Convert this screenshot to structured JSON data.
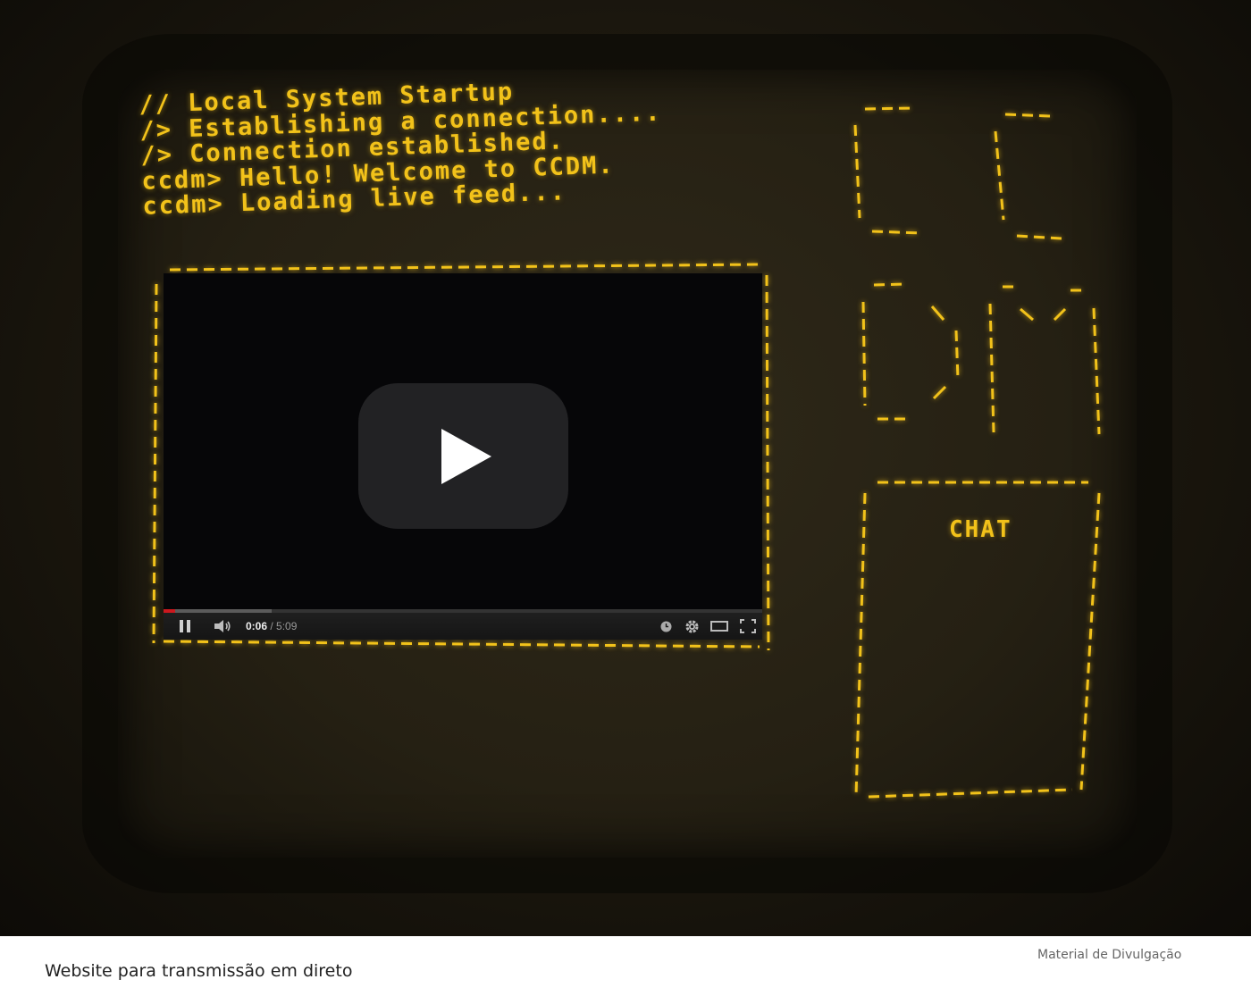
{
  "terminal": {
    "lines": [
      "// Local System Startup",
      "/> Establishing a connection....",
      "/> Connection established.",
      "ccdm> Hello! Welcome to CCDM.",
      "ccdm> Loading live feed..."
    ]
  },
  "video": {
    "current_time": "0:06",
    "separator": " / ",
    "duration": "5:09",
    "progress_fraction": 0.019,
    "buffered_fraction": 0.18,
    "icons": [
      "play-icon",
      "pause-icon",
      "volume-icon",
      "watch-later-icon",
      "settings-icon",
      "theater-mode-icon",
      "fullscreen-icon"
    ]
  },
  "chat": {
    "title": "CHAT"
  },
  "footer": {
    "caption": "Website para transmissão em direto",
    "credit": "Material de Divulgação"
  },
  "colors": {
    "terminal_amber": "#f2c21a",
    "progress_red": "#cc181e",
    "screen_bg": "#252013"
  }
}
